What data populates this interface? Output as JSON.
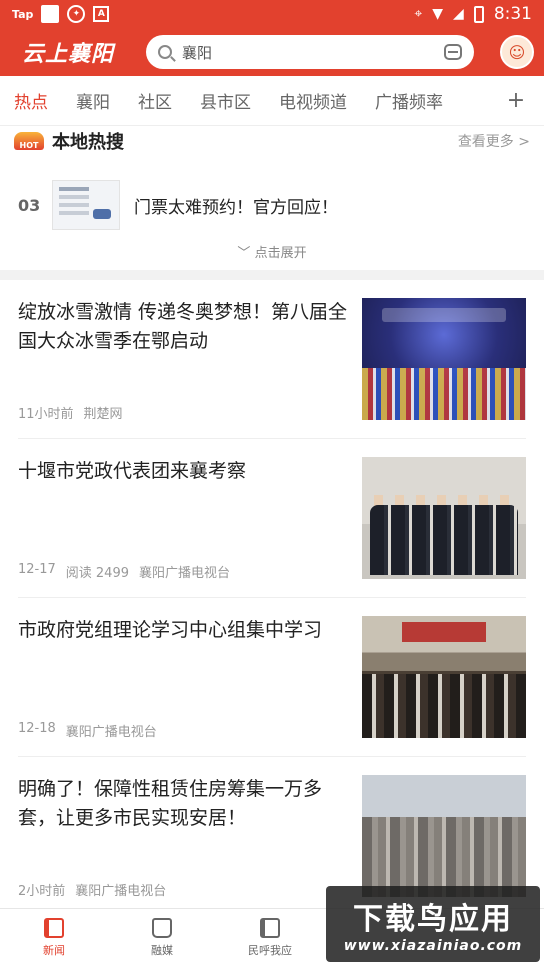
{
  "status_bar": {
    "app_label": "Tap",
    "time": "8:31"
  },
  "app_bar": {
    "logo_text": "云上襄阳",
    "search_text": "襄阳"
  },
  "tabs": [
    {
      "label": "热点",
      "active": true
    },
    {
      "label": "襄阳"
    },
    {
      "label": "社区"
    },
    {
      "label": "县市区"
    },
    {
      "label": "电视频道"
    },
    {
      "label": "广播频率"
    }
  ],
  "hot_search": {
    "title": "本地热搜",
    "more_label": "查看更多 >",
    "rank": "03",
    "item_text": "门票太难预约！官方回应！",
    "expand_label": "点击展开"
  },
  "news": [
    {
      "title": "绽放冰雪激情 传递冬奥梦想！第八届全国大众冰雪季在鄂启动",
      "time": "11小时前",
      "read": "",
      "source": "荆楚网"
    },
    {
      "title": "十堰市党政代表团来襄考察",
      "time": "12-17",
      "read": "阅读 2499",
      "source": "襄阳广播电视台"
    },
    {
      "title": "市政府党组理论学习中心组集中学习",
      "time": "12-18",
      "read": "",
      "source": "襄阳广播电视台"
    },
    {
      "title": "明确了！保障性租赁住房筹集一万多套，让更多市民实现安居！",
      "time": "2小时前",
      "read": "",
      "source": "襄阳广播电视台"
    }
  ],
  "bottom_nav": [
    {
      "label": "新闻",
      "active": true
    },
    {
      "label": "融媒"
    },
    {
      "label": "民呼我应"
    }
  ],
  "watermark": {
    "line1": "下载鸟应用",
    "line2": "www.xiazainiao.com"
  },
  "colors": {
    "brand": "#e2412e"
  }
}
